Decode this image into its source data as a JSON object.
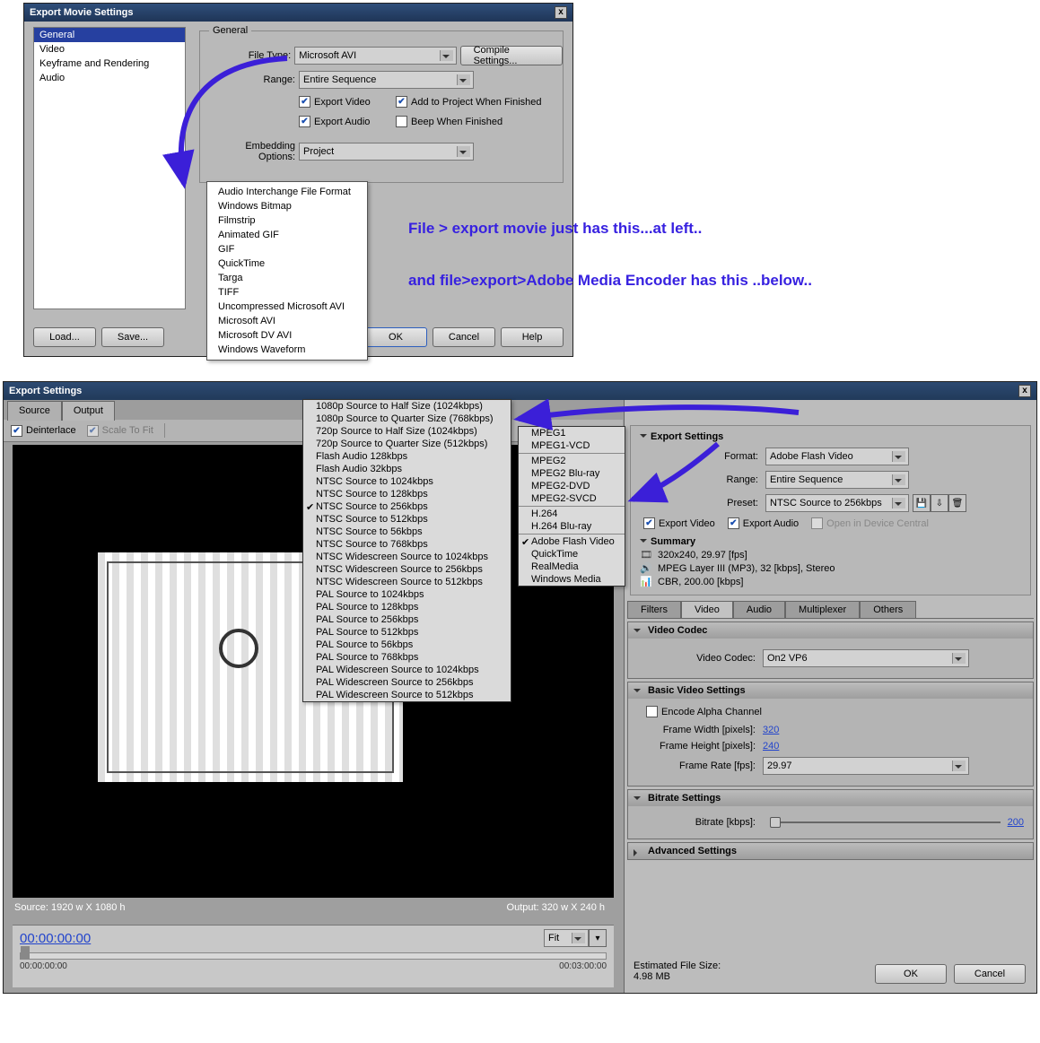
{
  "dialog1": {
    "title": "Export Movie Settings",
    "sidebar": [
      "General",
      "Video",
      "Keyframe and Rendering",
      "Audio"
    ],
    "section": "General",
    "file_type_label": "File Type:",
    "file_type": "Microsoft AVI",
    "compile_btn": "Compile Settings...",
    "range_label": "Range:",
    "range": "Entire Sequence",
    "export_video": "Export Video",
    "export_audio": "Export Audio",
    "add_project": "Add to Project When Finished",
    "beep": "Beep When Finished",
    "embed_label": "Embedding Options:",
    "embed": "Project",
    "load": "Load...",
    "save": "Save...",
    "ok": "OK",
    "cancel": "Cancel",
    "help": "Help"
  },
  "popup1": [
    "Audio Interchange File Format",
    "Windows Bitmap",
    "Filmstrip",
    "Animated GIF",
    "GIF",
    "QuickTime",
    "Targa",
    "TIFF",
    "Uncompressed Microsoft AVI",
    "Microsoft AVI",
    "Microsoft DV AVI",
    "Windows Waveform"
  ],
  "annot": {
    "line1": "File > export movie just has this...at left..",
    "line2": "and file>export>Adobe Media Encoder has this ..below.."
  },
  "dialog2": {
    "title": "Export Settings",
    "tabs": [
      "Source",
      "Output"
    ],
    "deinterlace": "Deinterlace",
    "scale": "Scale To Fit",
    "settings_head": "Export Settings",
    "format_label": "Format:",
    "format": "Adobe Flash Video",
    "range_label": "Range:",
    "range": "Entire Sequence",
    "preset_label": "Preset:",
    "preset": "NTSC Source to 256kbps",
    "export_video": "Export Video",
    "export_audio": "Export Audio",
    "open_device": "Open in Device Central",
    "summary_head": "Summary",
    "summary": [
      "320x240, 29.97 [fps]",
      "MPEG Layer III (MP3), 32 [kbps], Stereo",
      "CBR, 200.00 [kbps]"
    ],
    "mini_tabs": [
      "Filters",
      "Video",
      "Audio",
      "Multiplexer",
      "Others"
    ],
    "vc_head": "Video Codec",
    "vc_label": "Video Codec:",
    "vc": "On2 VP6",
    "bvs_head": "Basic Video Settings",
    "alpha": "Encode Alpha Channel",
    "fw_label": "Frame Width [pixels]:",
    "fw": "320",
    "fh_label": "Frame Height [pixels]:",
    "fh": "240",
    "fr_label": "Frame Rate [fps]:",
    "fr": "29.97",
    "bs_head": "Bitrate Settings",
    "br_label": "Bitrate [kbps]:",
    "br": "200",
    "adv_head": "Advanced Settings",
    "source_dim": "Source: 1920 w X 1080 h",
    "output_dim": "Output: 320 w X 240 h",
    "playhead": "00:00:00:00",
    "endtime": "00:03:00:00",
    "fit": "Fit",
    "est_label": "Estimated File Size:",
    "est": "4.98 MB",
    "ok": "OK",
    "cancel": "Cancel"
  },
  "presets": [
    {
      "t": "1080p Source to Half Size (1024kbps)"
    },
    {
      "t": "1080p Source to Quarter Size (768kbps)"
    },
    {
      "t": "720p Source to Half Size (1024kbps)"
    },
    {
      "t": "720p Source to Quarter Size (512kbps)"
    },
    {
      "t": "Flash Audio 128kbps"
    },
    {
      "t": "Flash Audio 32kbps"
    },
    {
      "t": "NTSC Source to 1024kbps"
    },
    {
      "t": "NTSC Source to 128kbps"
    },
    {
      "t": "NTSC Source to 256kbps",
      "c": true
    },
    {
      "t": "NTSC Source to 512kbps"
    },
    {
      "t": "NTSC Source to 56kbps"
    },
    {
      "t": "NTSC Source to 768kbps"
    },
    {
      "t": "NTSC Widescreen Source to 1024kbps"
    },
    {
      "t": "NTSC Widescreen Source to 256kbps"
    },
    {
      "t": "NTSC Widescreen Source to 512kbps"
    },
    {
      "t": "PAL Source to 1024kbps"
    },
    {
      "t": "PAL Source to 128kbps"
    },
    {
      "t": "PAL Source to 256kbps"
    },
    {
      "t": "PAL Source to 512kbps"
    },
    {
      "t": "PAL Source to 56kbps"
    },
    {
      "t": "PAL Source to 768kbps"
    },
    {
      "t": "PAL Widescreen Source to 1024kbps"
    },
    {
      "t": "PAL Widescreen Source to 256kbps"
    },
    {
      "t": "PAL Widescreen Source to 512kbps"
    }
  ],
  "formats": [
    [
      "MPEG1",
      "MPEG1-VCD"
    ],
    [
      "MPEG2",
      "MPEG2 Blu-ray",
      "MPEG2-DVD",
      "MPEG2-SVCD"
    ],
    [
      "H.264",
      "H.264 Blu-ray"
    ],
    [
      "Adobe Flash Video",
      "QuickTime",
      "RealMedia",
      "Windows Media"
    ]
  ],
  "format_selected": "Adobe Flash Video"
}
